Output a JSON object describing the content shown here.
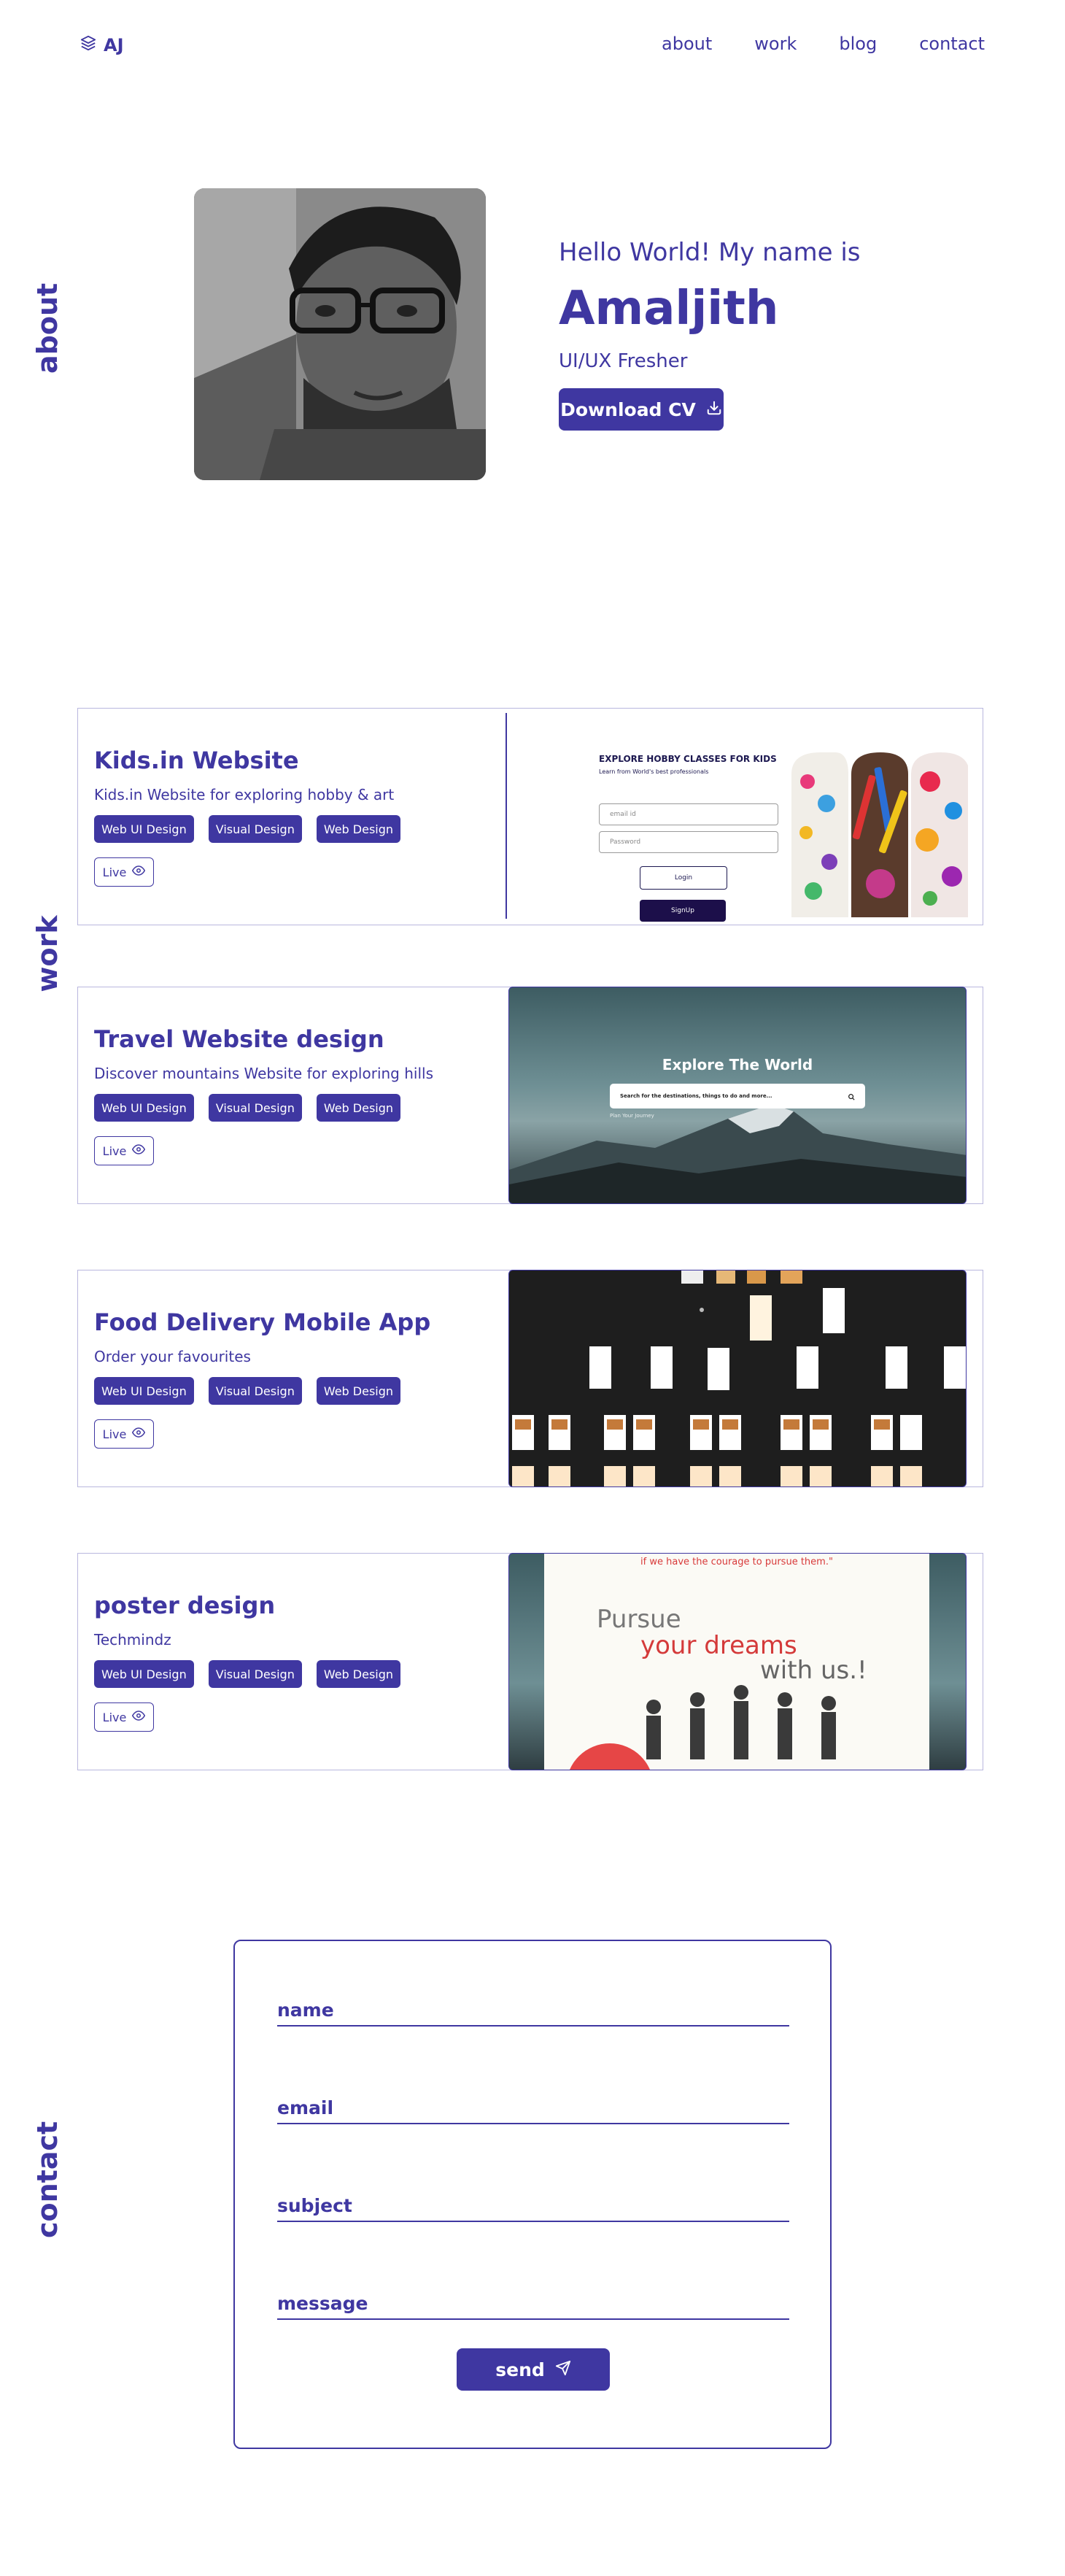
{
  "header": {
    "logo_text": "AJ",
    "nav": [
      "about",
      "work",
      "blog",
      "contact"
    ]
  },
  "sections": {
    "about_label": "about",
    "work_label": "work",
    "contact_label": "contact"
  },
  "about": {
    "greeting": "Hello World! My name is",
    "name": "Amaljith",
    "role": "UI/UX Fresher",
    "cv_button": "Download CV"
  },
  "work": {
    "projects": [
      {
        "title": "Kids.in Website",
        "subtitle": "Kids.in Website for exploring hobby & art",
        "tags": [
          "Web UI Design",
          "Visual Design",
          "Web Design"
        ],
        "live": "Live",
        "preview": {
          "heading": "EXPLORE HOBBY CLASSES FOR KIDS",
          "subheading": "Learn from World's best professionals",
          "email_placeholder": "email id",
          "password_placeholder": "Password",
          "login": "Login",
          "signup": "SignUp"
        }
      },
      {
        "title": "Travel Website design",
        "subtitle": "Discover mountains Website for exploring hills",
        "tags": [
          "Web UI Design",
          "Visual Design",
          "Web Design"
        ],
        "live": "Live",
        "preview": {
          "heading": "Explore The World",
          "search_placeholder": "Search for the destinations, things to do and more...",
          "caption": "Plan Your Journey"
        }
      },
      {
        "title": "Food Delivery Mobile App",
        "subtitle": "Order your favourites",
        "tags": [
          "Web UI Design",
          "Visual Design",
          "Web Design"
        ],
        "live": "Live"
      },
      {
        "title": "poster design",
        "subtitle": "Techmindz",
        "tags": [
          "Web UI Design",
          "Visual Design",
          "Web Design"
        ],
        "live": "Live",
        "preview": {
          "quote": "if we have the courage to pursue them.\"",
          "line1": "Pursue",
          "line2": "your dreams",
          "line3": "with us.!"
        }
      }
    ]
  },
  "contact": {
    "fields": [
      "name",
      "email",
      "subject",
      "message"
    ],
    "send_button": "send"
  },
  "colors": {
    "accent": "#3f37a1",
    "border": "#b9b7de"
  }
}
